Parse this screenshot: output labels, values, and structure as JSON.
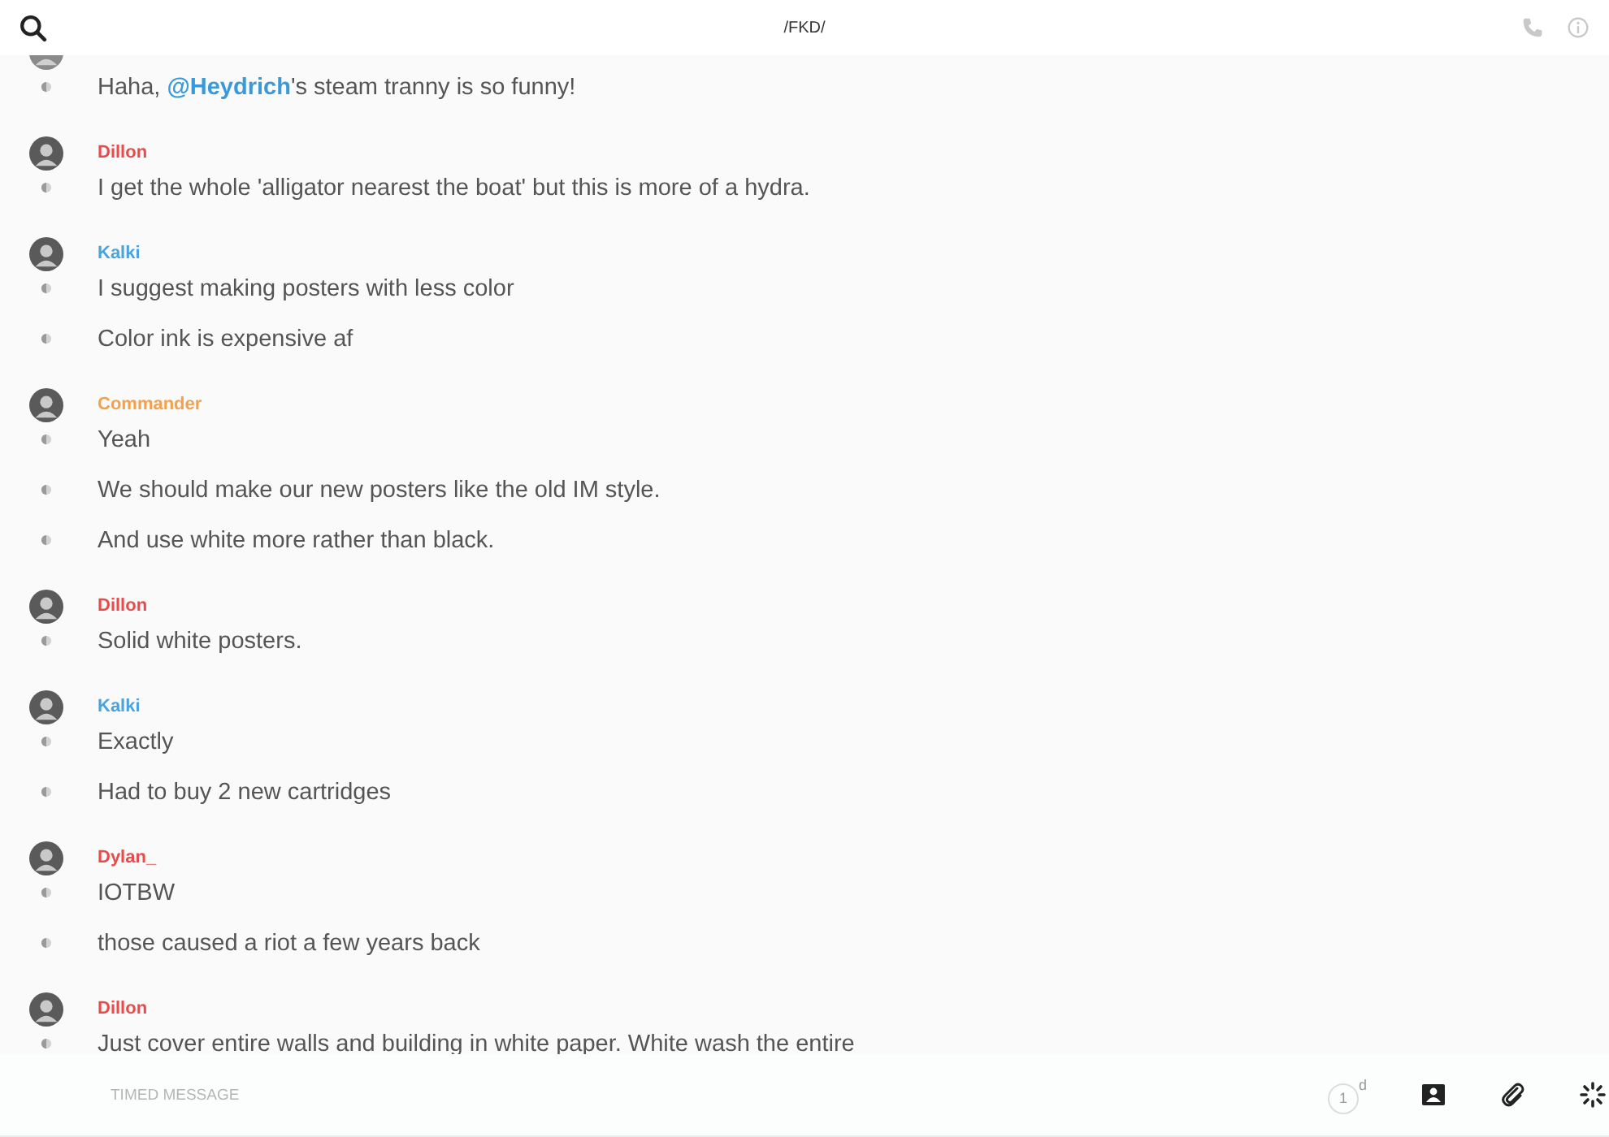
{
  "header": {
    "title": "/FKD/"
  },
  "groups": [
    {
      "messages": [
        "Haha, **@Heydrich**'s steam tranny is so funny!"
      ]
    },
    {
      "author": "Dillon",
      "color": "#e94b4b",
      "messages": [
        "I get the whole 'alligator nearest the boat' but this is more of a hydra."
      ]
    },
    {
      "author": "Kalki",
      "color": "#4aa3df",
      "messages": [
        "I suggest making posters with less color",
        "Color ink is expensive af"
      ]
    },
    {
      "author": "Commander",
      "color": "#f5a04a",
      "messages": [
        "Yeah",
        "We should make our new posters like the old IM style.",
        "And use white more rather than black."
      ]
    },
    {
      "author": "Dillon",
      "color": "#e94b4b",
      "messages": [
        "Solid white posters."
      ]
    },
    {
      "author": "Kalki",
      "color": "#4aa3df",
      "messages": [
        "Exactly",
        "Had to buy 2 new cartridges"
      ]
    },
    {
      "author": "Dylan_",
      "color": "#e94b4b",
      "messages": [
        "IOTBW",
        "those caused a riot a few years back"
      ]
    },
    {
      "author": "Dillon",
      "color": "#e94b4b",
      "messages": [
        "Just cover entire walls and building in white paper. White wash the entire"
      ]
    }
  ],
  "composer": {
    "placeholder": "TIMED MESSAGE",
    "timer_value": "1",
    "timer_unit": "d"
  }
}
